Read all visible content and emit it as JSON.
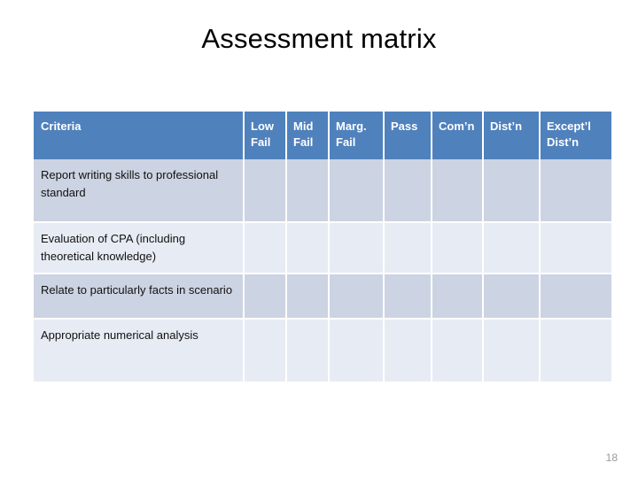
{
  "slide": {
    "title": "Assessment matrix",
    "page_number": "18",
    "accent_color": "#4f81bd",
    "row_dark_color": "#ccd3e2",
    "row_light_color": "#e7ebf4"
  },
  "table": {
    "headers": [
      "Criteria",
      "Low Fail",
      "Mid Fail",
      "Marg. Fail",
      "Pass",
      "Com’n",
      "Dist’n",
      "Except’l Dist’n"
    ],
    "rows": [
      {
        "criteria": "Report writing skills to professional standard",
        "low_fail": "",
        "mid_fail": "",
        "marg_fail": "",
        "pass": "",
        "com_n": "",
        "dist_n": "",
        "except_l_dist_n": ""
      },
      {
        "criteria": "Evaluation of CPA  (including theoretical knowledge)",
        "low_fail": "",
        "mid_fail": "",
        "marg_fail": "",
        "pass": "",
        "com_n": "",
        "dist_n": "",
        "except_l_dist_n": ""
      },
      {
        "criteria": "Relate to particularly facts in scenario",
        "low_fail": "",
        "mid_fail": "",
        "marg_fail": "",
        "pass": "",
        "com_n": "",
        "dist_n": "",
        "except_l_dist_n": ""
      },
      {
        "criteria": "Appropriate numerical analysis",
        "low_fail": "",
        "mid_fail": "",
        "marg_fail": "",
        "pass": "",
        "com_n": "",
        "dist_n": "",
        "except_l_dist_n": ""
      }
    ]
  }
}
